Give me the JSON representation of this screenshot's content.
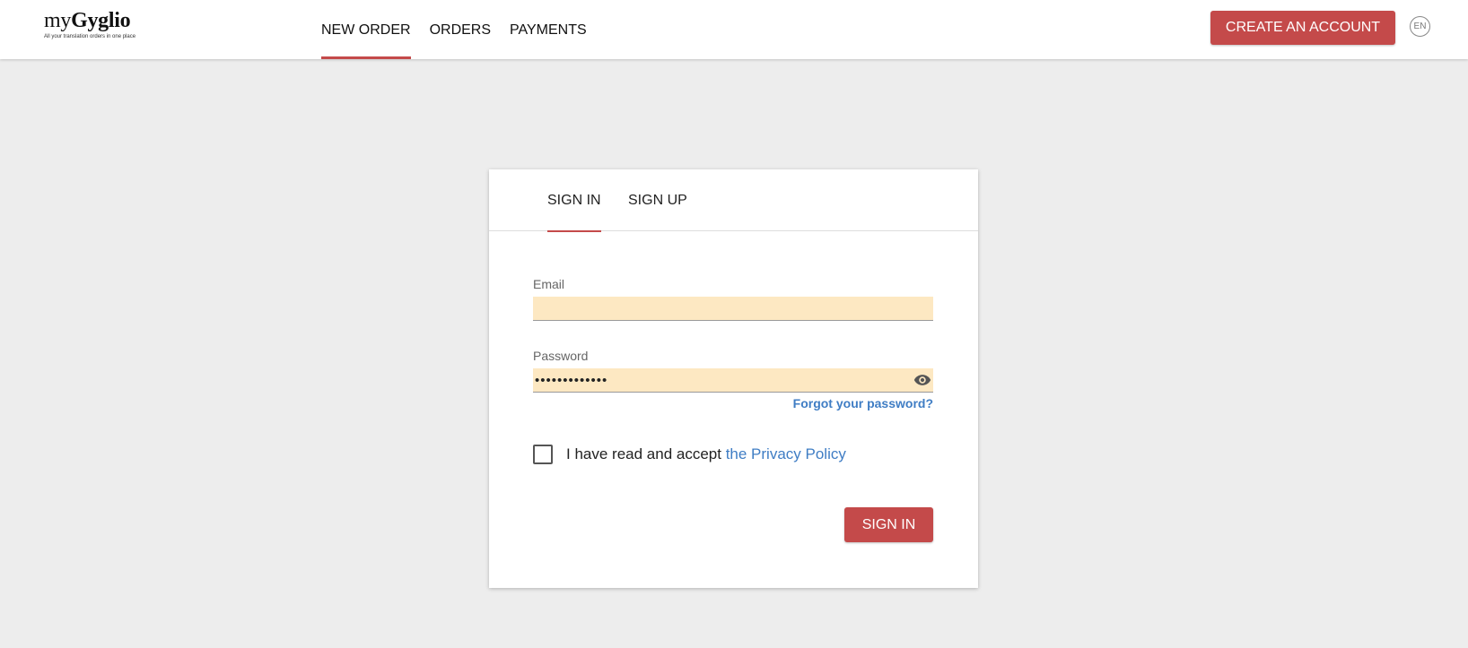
{
  "logo": {
    "prefix": "my",
    "brand": "Gyglio",
    "tagline": "All your translation orders in one place"
  },
  "nav": {
    "items": [
      {
        "label": "NEW ORDER",
        "active": true
      },
      {
        "label": "ORDERS",
        "active": false
      },
      {
        "label": "PAYMENTS",
        "active": false
      }
    ]
  },
  "header": {
    "create_account_label": "CREATE AN ACCOUNT",
    "language": "EN"
  },
  "auth": {
    "tabs": [
      {
        "label": "SIGN IN",
        "active": true
      },
      {
        "label": "SIGN UP",
        "active": false
      }
    ],
    "email": {
      "label": "Email",
      "value": ""
    },
    "password": {
      "label": "Password",
      "value": "•••••••••••••"
    },
    "forgot_label": "Forgot your password?",
    "consent": {
      "text": "I have read and accept ",
      "link_text": "the Privacy Policy",
      "checked": false
    },
    "submit_label": "SIGN IN"
  },
  "icons": {
    "password_toggle": "eye-icon"
  },
  "colors": {
    "accent": "#c44a4a",
    "link": "#3f7dc4",
    "autofill": "#fde8c2",
    "background": "#ededed"
  }
}
